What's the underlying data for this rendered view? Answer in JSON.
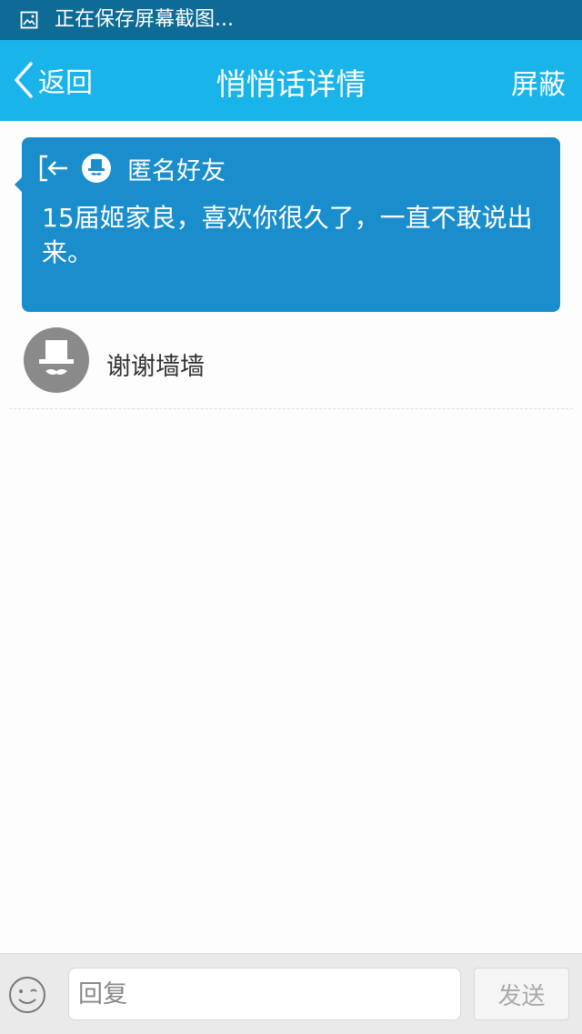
{
  "status_bar": {
    "text": "正在保存屏幕截图...",
    "icon": "image-icon"
  },
  "nav": {
    "back_label": "返回",
    "title": "悄悄话详情",
    "block_label": "屏蔽"
  },
  "message_card": {
    "sender": "匿名好友",
    "text": "15届姬家良，喜欢你很久了，一直不敢说出来。"
  },
  "replies": [
    {
      "text": "谢谢墙墙"
    }
  ],
  "composer": {
    "placeholder": "回复",
    "send_label": "发送"
  },
  "colors": {
    "status_bar": "#0d6b96",
    "nav_bar": "#19b4ea",
    "card": "#1a8ecd"
  }
}
